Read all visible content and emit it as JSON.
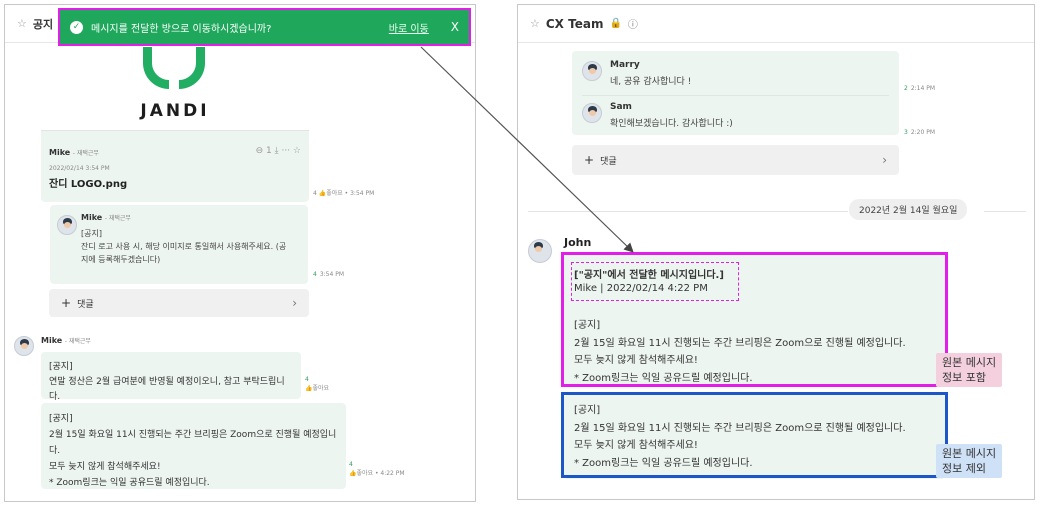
{
  "left": {
    "channel_title": "공지",
    "toast": {
      "message": "메시지를 전달한 방으로 이동하시겠습니까?",
      "go_label": "바로 이동",
      "close": "X"
    },
    "logo_card": {
      "logo_text": "JANDI",
      "sender": "Mike",
      "status": "- 재택근무",
      "actions": "⊖ 1   ⤓   ···   ☆",
      "date": "2022/02/14 3:54 PM",
      "file_name": "잔디 LOGO.png",
      "meta": "4 👍좋아요 • 3:54 PM"
    },
    "quoted": {
      "sender": "Mike",
      "status": "- 재택근무",
      "line1": "[공지]",
      "line2": "잔디 로고 사용 시, 해당 이미지로 통일해서 사용해주세요. (공",
      "line3": "지에 등록해두겠습니다)",
      "meta_count": "4",
      "meta_time": "3:54 PM"
    },
    "reply_bar": {
      "label": "댓글"
    },
    "mike_msgs": {
      "sender": "Mike",
      "status": "- 재택근무",
      "msg1_line1": "[공지]",
      "msg1_line2": "연말 정산은 2월 급여분에 반영될 예정이오니, 참고 부탁드립니다.",
      "msg1_meta_count": "4",
      "msg1_meta_like": "좋아요",
      "msg2_line1": "[공지]",
      "msg2_line2": "2월 15일 화요일 11시 진행되는 주간 브리핑은 Zoom으로 진행될 예정입니다.",
      "msg2_line3": "모두 늦지 않게 참석해주세요!",
      "msg2_line4": "* Zoom링크는 익일 공유드릴 예정입니다.",
      "msg2_meta_count": "4",
      "msg2_meta": "좋아요 • 4:22 PM"
    }
  },
  "right": {
    "channel_title": "CX Team",
    "marry": {
      "name": "Marry",
      "text": "네, 공유 감사합니다 !",
      "count": "2",
      "time": "2:14 PM"
    },
    "sam": {
      "name": "Sam",
      "text": "확인해보겠습니다. 감사합니다 :)",
      "count": "3",
      "time": "2:20 PM"
    },
    "reply_bar": {
      "label": "댓글"
    },
    "date": "2022년 2월 14일 월요일",
    "john": {
      "name": "John",
      "forward_title": "[\"공지\"에서 전달한 메시지입니다.]",
      "forward_source": "Mike | 2022/02/14 4:22 PM",
      "line1": "[공지]",
      "line2": "2월 15일 화요일 11시 진행되는 주간 브리핑은 Zoom으로 진행될 예정입니다.",
      "line3": "모두 늦지 않게 참석해주세요!",
      "line4": "* Zoom링크는 익일 공유드릴 예정입니다."
    },
    "plain": {
      "line1": "[공지]",
      "line2": "2월 15일 화요일 11시 진행되는 주간 브리핑은 Zoom으로 진행될 예정입니다.",
      "line3": "모두 늦지 않게 참석해주세요!",
      "line4": "* Zoom링크는 익일 공유드릴 예정입니다."
    },
    "tag_include": {
      "line1": "원본 메시지",
      "line2": "정보 포함"
    },
    "tag_exclude": {
      "line1": "원본 메시지",
      "line2": "정보 제외"
    }
  },
  "colors": {
    "accent_green": "#1fa85c",
    "highlight_pink": "#e21ee8",
    "highlight_blue": "#1d56c8",
    "bubble_bg": "#edf5f0"
  }
}
